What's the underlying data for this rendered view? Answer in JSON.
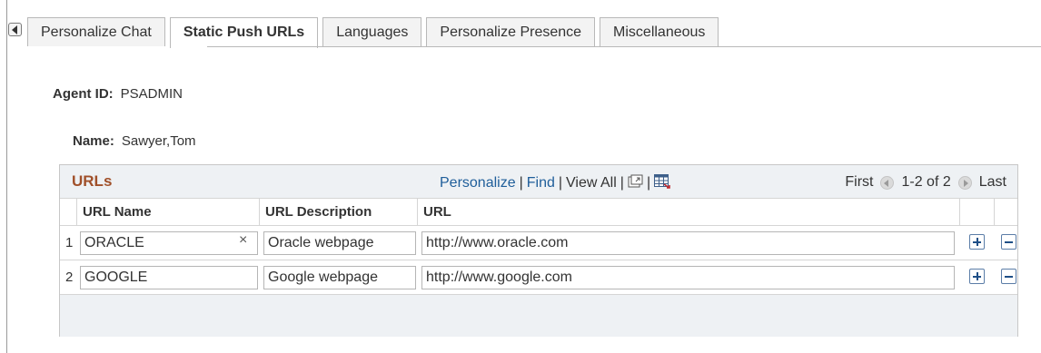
{
  "tabs": [
    {
      "label": "Personalize Chat",
      "active": false
    },
    {
      "label": "Static Push URLs",
      "active": true
    },
    {
      "label": "Languages",
      "active": false
    },
    {
      "label": "Personalize Presence",
      "active": false
    },
    {
      "label": "Miscellaneous",
      "active": false
    }
  ],
  "fields": {
    "agent_id_label": "Agent ID:",
    "agent_id_value": "PSADMIN",
    "name_label": "Name:",
    "name_value": "Sawyer,Tom"
  },
  "grid": {
    "title": "URLs",
    "personalize": "Personalize",
    "find": "Find",
    "view_all": "View All",
    "first": "First",
    "range": "1-2 of 2",
    "last": "Last",
    "columns": [
      "URL Name",
      "URL Description",
      "URL"
    ],
    "rows": [
      {
        "num": "1",
        "name": "ORACLE",
        "description": "Oracle webpage",
        "url": "http://www.oracle.com"
      },
      {
        "num": "2",
        "name": "GOOGLE",
        "description": "Google webpage",
        "url": "http://www.google.com"
      }
    ]
  },
  "colors": {
    "grid_title": "#a0502a",
    "link": "#1f5e9a",
    "grid_header_bg": "#eef1f4"
  }
}
